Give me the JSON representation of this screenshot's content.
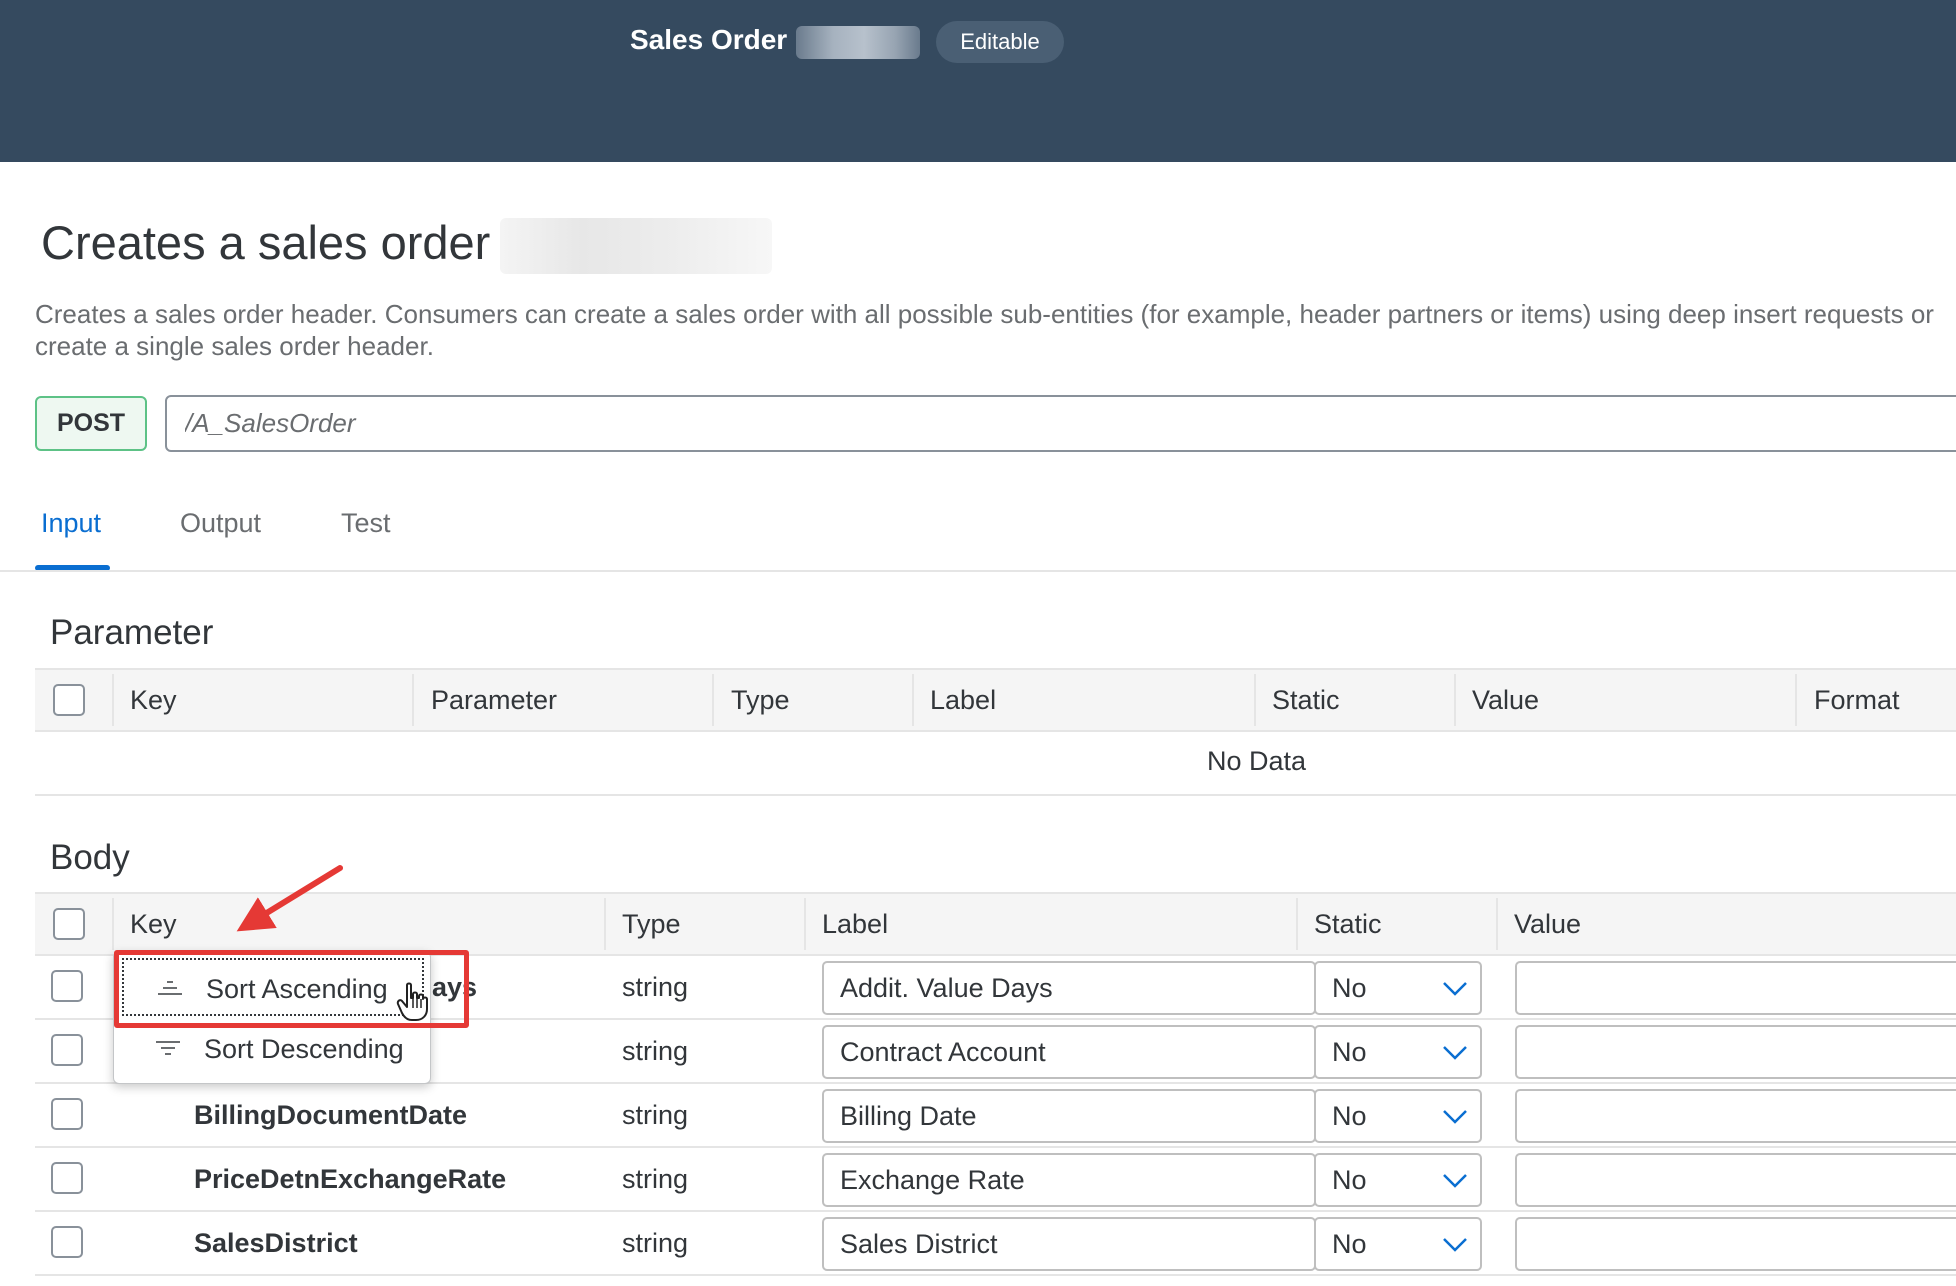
{
  "shell": {
    "title": "Sales Order -",
    "badge": "Editable"
  },
  "page": {
    "title": "Creates a sales order",
    "description": "Creates a sales order header. Consumers can create a sales order with all possible sub-entities (for example, header partners or items) using deep insert requests or create a single sales order header.",
    "method": "POST",
    "path": "/A_SalesOrder"
  },
  "tabs": [
    {
      "label": "Input",
      "active": true
    },
    {
      "label": "Output",
      "active": false
    },
    {
      "label": "Test",
      "active": false
    }
  ],
  "parameter_section": {
    "title": "Parameter",
    "columns": [
      "Key",
      "Parameter",
      "Type",
      "Label",
      "Static",
      "Value",
      "Format"
    ],
    "empty_text": "No Data"
  },
  "body_section": {
    "title": "Body",
    "columns": [
      "Key",
      "Type",
      "Label",
      "Static",
      "Value"
    ],
    "rows": [
      {
        "key": "",
        "key_visible_fragment": "ays",
        "type": "string",
        "label": "Addit. Value Days",
        "static": "No",
        "value": ""
      },
      {
        "key": "",
        "type": "string",
        "label": "Contract Account",
        "static": "No",
        "value": ""
      },
      {
        "key": "BillingDocumentDate",
        "type": "string",
        "label": "Billing Date",
        "static": "No",
        "value": ""
      },
      {
        "key": "PriceDetnExchangeRate",
        "type": "string",
        "label": "Exchange Rate",
        "static": "No",
        "value": ""
      },
      {
        "key": "SalesDistrict",
        "type": "string",
        "label": "Sales District",
        "static": "No",
        "value": ""
      }
    ]
  },
  "sort_menu": {
    "items": [
      {
        "label": "Sort Ascending",
        "icon": "sort-ascending-icon",
        "focused": true
      },
      {
        "label": "Sort Descending",
        "icon": "sort-descending-icon",
        "focused": false
      }
    ]
  },
  "colors": {
    "shell_bg": "#354a5f",
    "accent": "#0a6ed1",
    "method_border": "#5dc286",
    "annotation_red": "#e53935"
  }
}
